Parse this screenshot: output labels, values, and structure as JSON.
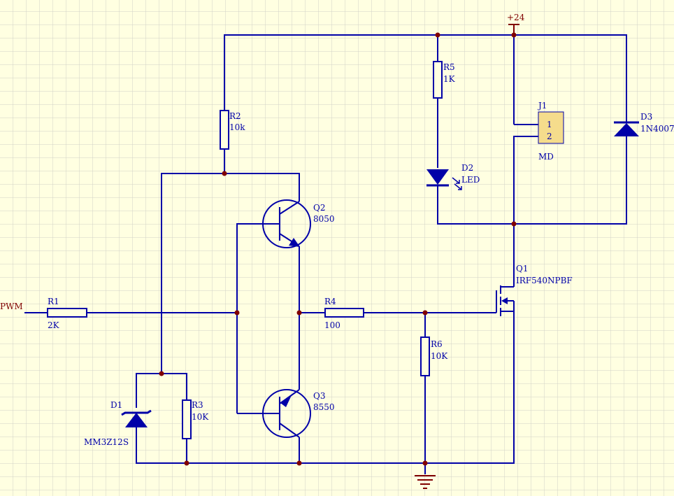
{
  "colors": {
    "background": "#FFFFE1",
    "grid": "#D2D2C8",
    "wire": "#0000A8",
    "junction": "#800000",
    "power_label": "#800000",
    "connector_fill": "#F5DC8C"
  },
  "ports": {
    "pwm": "PWM",
    "vcc": "+24"
  },
  "components": {
    "r1": {
      "ref": "R1",
      "value": "2K"
    },
    "r2": {
      "ref": "R2",
      "value": "10k"
    },
    "r3": {
      "ref": "R3",
      "value": "10K"
    },
    "r4": {
      "ref": "R4",
      "value": "100"
    },
    "r5": {
      "ref": "R5",
      "value": "1K"
    },
    "r6": {
      "ref": "R6",
      "value": "10K"
    },
    "q1": {
      "ref": "Q1",
      "value": "IRF540NPBF"
    },
    "q2": {
      "ref": "Q2",
      "value": "8050"
    },
    "q3": {
      "ref": "Q3",
      "value": "8550"
    },
    "d1": {
      "ref": "D1",
      "value": "MM3Z12S"
    },
    "d2": {
      "ref": "D2",
      "value": "LED"
    },
    "d3": {
      "ref": "D3",
      "value": "1N4007"
    },
    "j1": {
      "ref": "J1",
      "value": "MD",
      "pin1": "1",
      "pin2": "2"
    }
  }
}
